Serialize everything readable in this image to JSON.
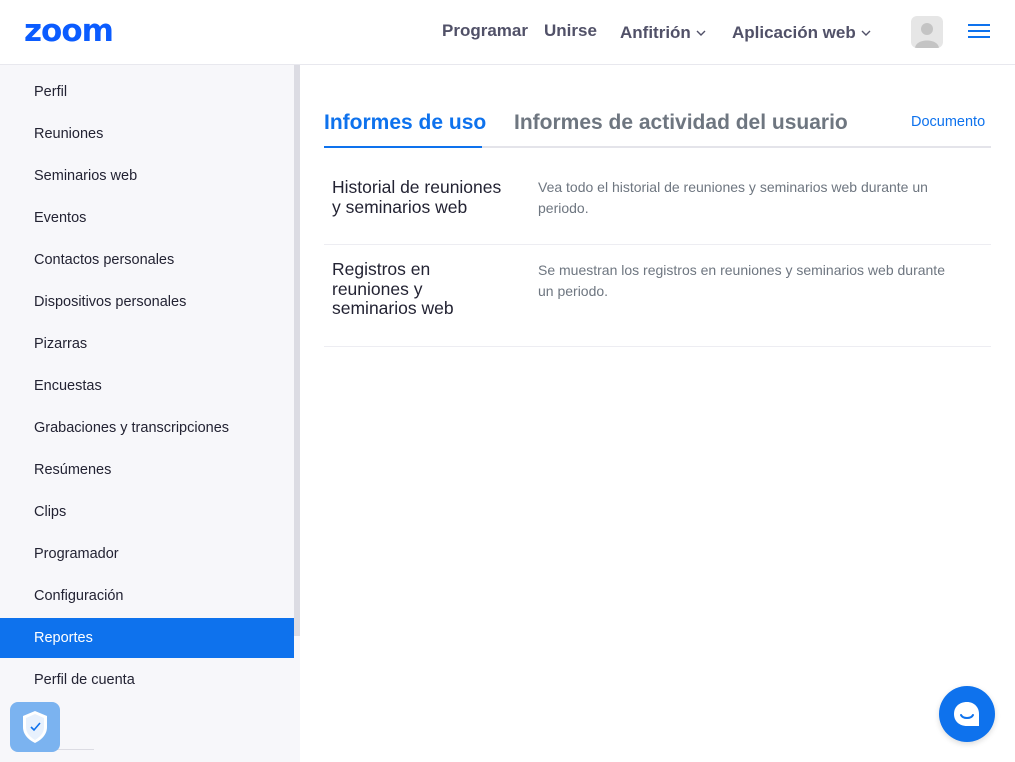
{
  "header": {
    "logo": "zoom",
    "nav": [
      {
        "label": "Programar",
        "has_dropdown": false
      },
      {
        "label": "Unirse",
        "has_dropdown": false
      },
      {
        "label": "Anfitrión",
        "has_dropdown": true
      },
      {
        "label": "Aplicación web",
        "has_dropdown": true
      }
    ],
    "avatar_icon": "user-avatar-icon",
    "menu_icon": "hamburger-menu-icon"
  },
  "sidebar": {
    "items": [
      {
        "label": "Perfil",
        "active": false
      },
      {
        "label": "Reuniones",
        "active": false
      },
      {
        "label": "Seminarios web",
        "active": false
      },
      {
        "label": "Eventos",
        "active": false
      },
      {
        "label": "Contactos personales",
        "active": false
      },
      {
        "label": "Dispositivos personales",
        "active": false
      },
      {
        "label": "Pizarras",
        "active": false
      },
      {
        "label": "Encuestas",
        "active": false
      },
      {
        "label": "Grabaciones y transcripciones",
        "active": false
      },
      {
        "label": "Resúmenes",
        "active": false
      },
      {
        "label": "Clips",
        "active": false
      },
      {
        "label": "Programador",
        "active": false
      },
      {
        "label": "Configuración",
        "active": false
      },
      {
        "label": "Reportes",
        "active": true
      },
      {
        "label": "Perfil de cuenta",
        "active": false
      }
    ]
  },
  "main": {
    "tabs": [
      {
        "label": "Informes de uso",
        "active": true
      },
      {
        "label": "Informes de actividad del usuario",
        "active": false
      }
    ],
    "doc_link": "Documento",
    "reports": [
      {
        "title_lines": [
          "Historial de reuniones",
          "y seminarios web"
        ],
        "desc_lines": [
          "Vea todo el historial de reuniones y seminarios web durante un",
          "periodo."
        ]
      },
      {
        "title_lines": [
          "Registros en",
          "reuniones y",
          "seminarios web"
        ],
        "desc_lines": [
          "Se muestran los registros en reuniones y seminarios web durante",
          "un periodo."
        ]
      }
    ]
  },
  "colors": {
    "brand_blue": "#0b5cff",
    "accent_blue": "#0e72ed",
    "sidebar_bg": "#f7f7fa",
    "text_muted": "#6e7680"
  }
}
